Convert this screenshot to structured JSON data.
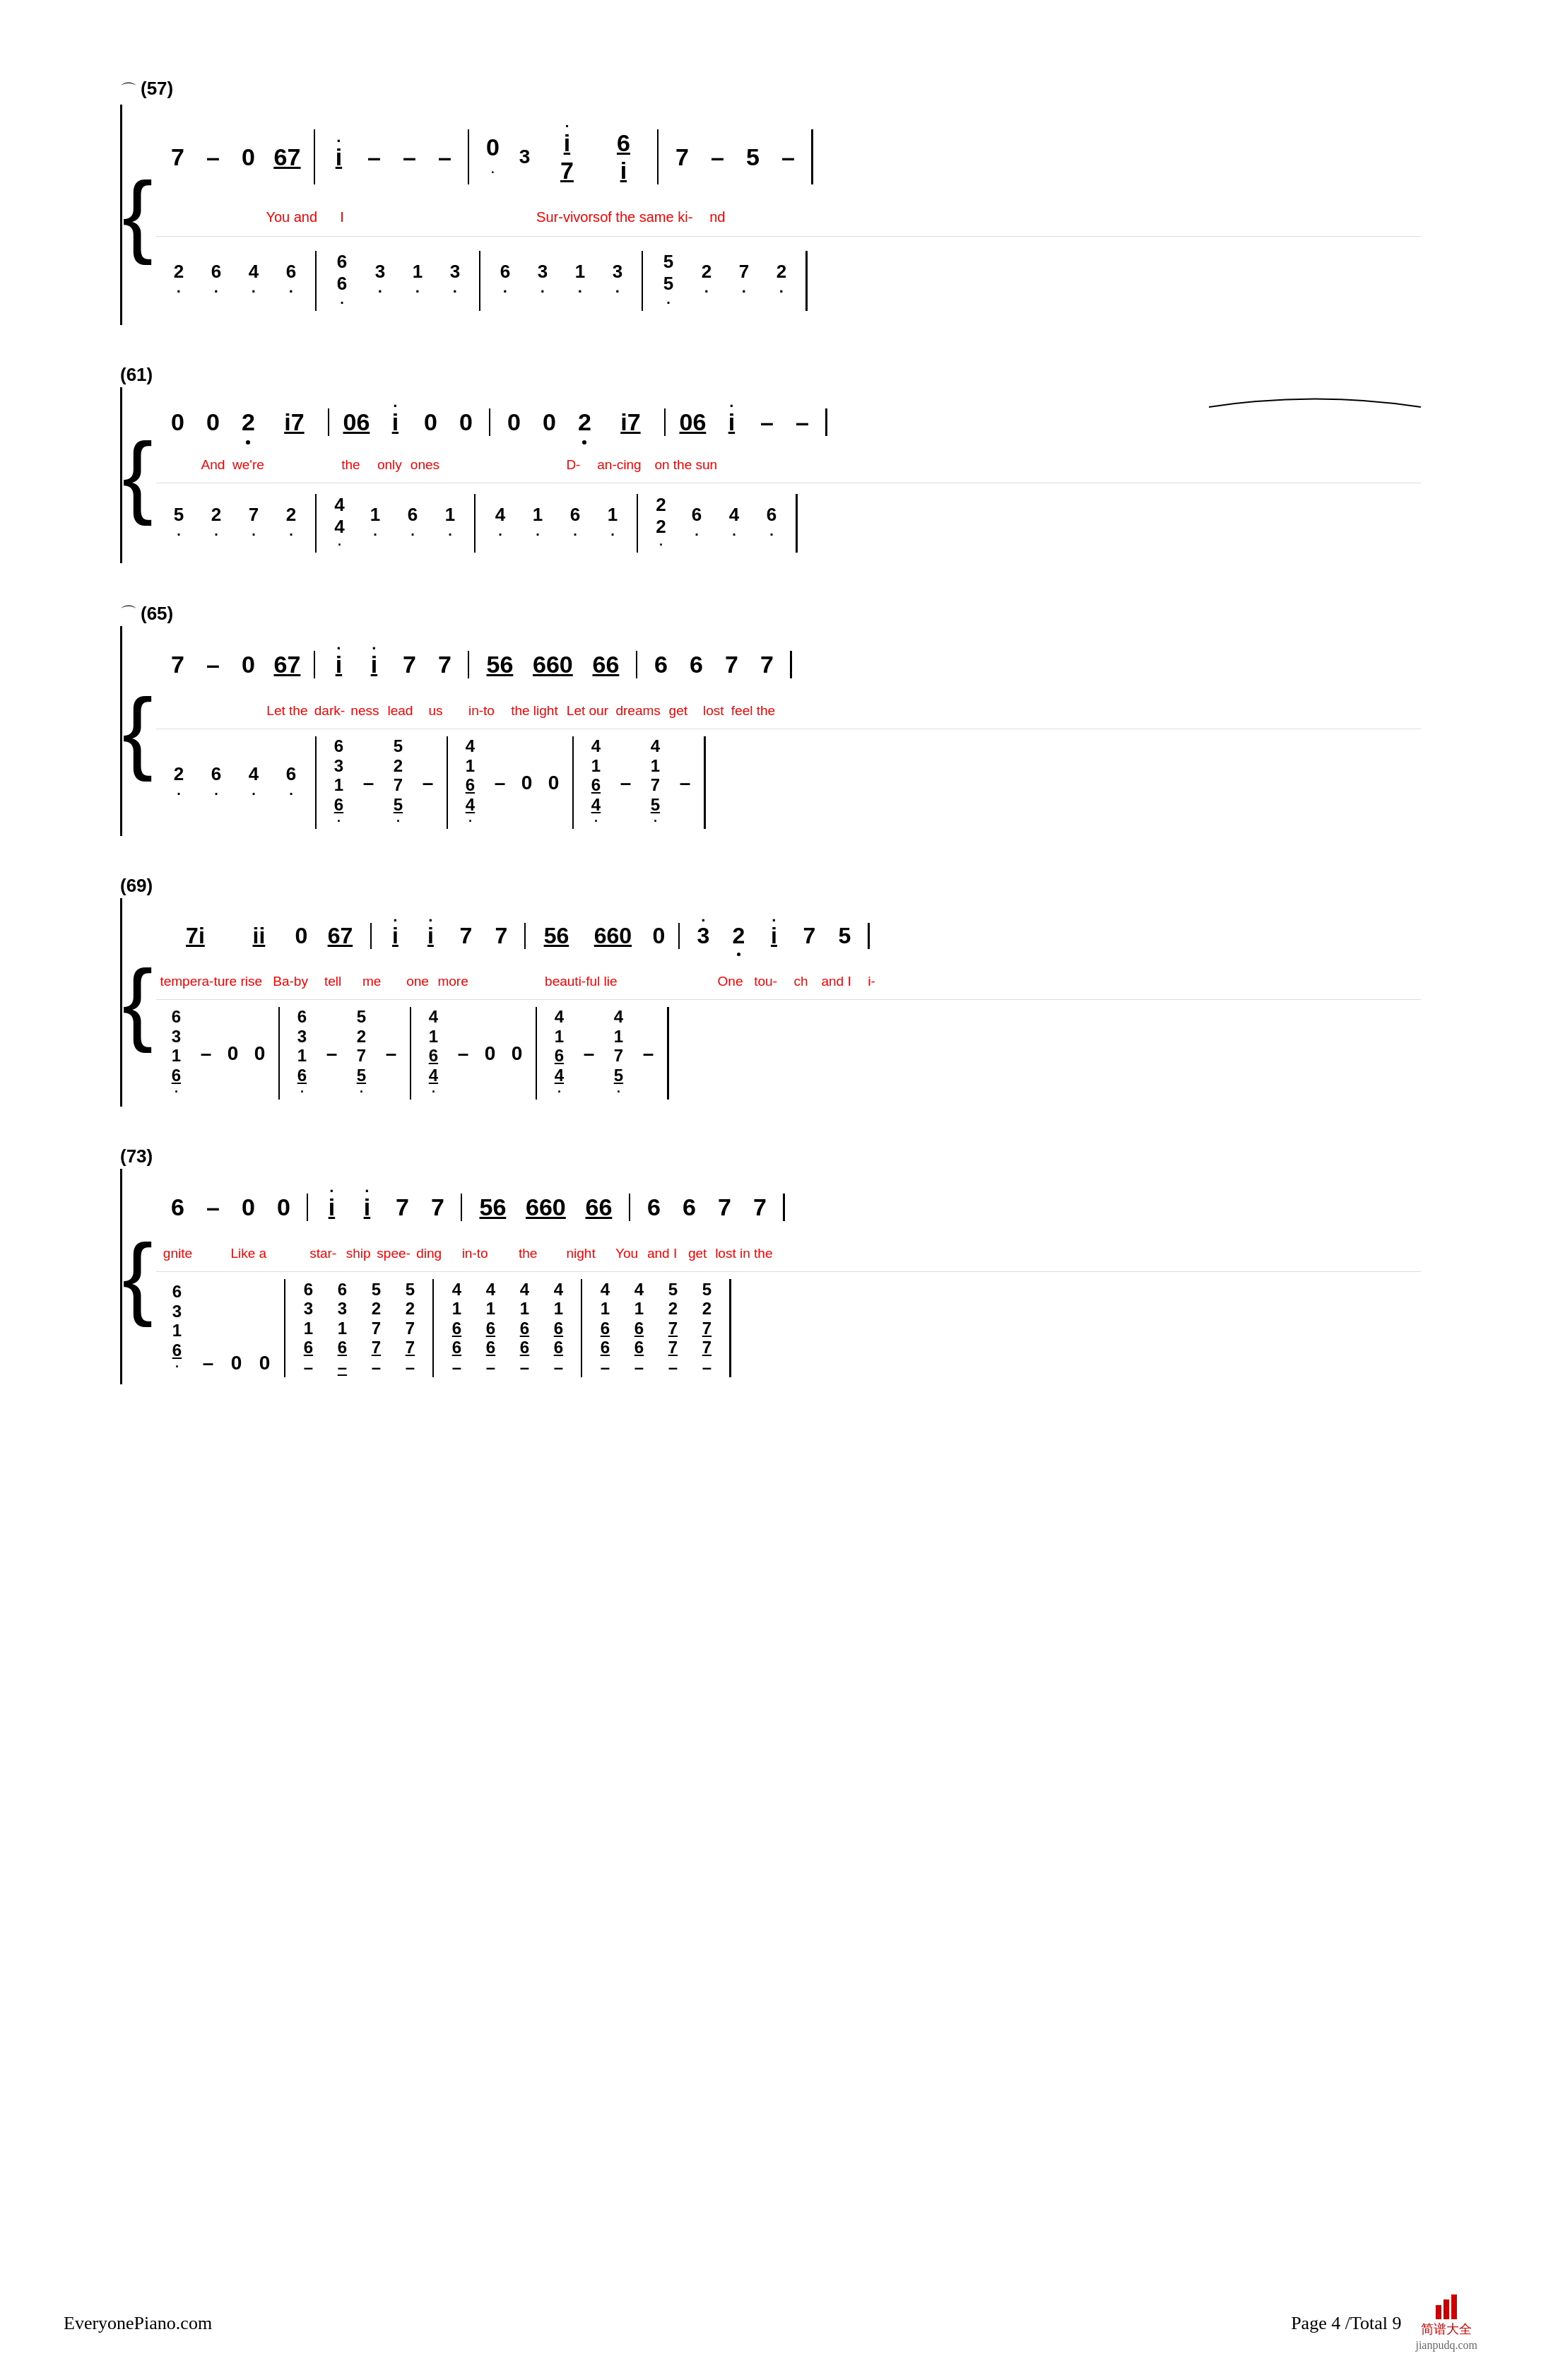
{
  "page": {
    "footer": {
      "website": "EveryonePiano.com",
      "page_info": "Page 4 /Total 9"
    }
  },
  "sections": [
    {
      "id": "57",
      "label": "(57)",
      "has_curve": true,
      "treble": {
        "notes": [
          "7",
          "–",
          "0",
          "67",
          "i",
          "–",
          "–",
          "–",
          "0·",
          "3",
          "i7",
          "6i",
          "7",
          "–",
          "5",
          "–"
        ],
        "underlines": [
          "67",
          "i7",
          "6i"
        ],
        "dots_above": [
          "i7"
        ],
        "lyrics": [
          "You and",
          "I",
          "",
          "",
          "",
          "",
          "",
          "",
          "",
          "Sur-vivors",
          "of the same ki-",
          "nd",
          "",
          "",
          "",
          ""
        ]
      },
      "bass": {
        "chords": [
          {
            "nums": [
              "2",
              "·"
            ]
          },
          {
            "nums": [
              "6",
              "·"
            ]
          },
          {
            "nums": [
              "4",
              "·"
            ]
          },
          {
            "nums": [
              "6",
              "·"
            ]
          },
          {
            "nums": [
              "6",
              "6",
              "·"
            ]
          },
          {
            "nums": [
              "3",
              "·"
            ]
          },
          {
            "nums": [
              "1",
              "·"
            ]
          },
          {
            "nums": [
              "3",
              "·"
            ]
          },
          {
            "nums": [
              "6",
              "·"
            ]
          },
          {
            "nums": [
              "3",
              "·"
            ]
          },
          {
            "nums": [
              "1",
              "·"
            ]
          },
          {
            "nums": [
              "3",
              "·"
            ]
          },
          {
            "nums": [
              "5",
              "5",
              "·"
            ]
          },
          {
            "nums": [
              "2",
              "·"
            ]
          },
          {
            "nums": [
              "7",
              "·"
            ]
          },
          {
            "nums": [
              "2",
              "·"
            ]
          }
        ]
      }
    },
    {
      "id": "61",
      "label": "(61)",
      "has_curve": false,
      "slur_right": true,
      "treble": {
        "notes": [
          "0",
          "0",
          "2̣",
          "i7",
          "06",
          "i",
          "0",
          "0",
          "0",
          "0",
          "2̣",
          "i7",
          "06",
          "i",
          "–",
          "–"
        ],
        "underlines": [
          "06",
          "i7"
        ],
        "lyrics": [
          "And",
          "we're",
          "the",
          "only",
          "ones",
          "",
          "",
          "",
          "D-",
          "an-cing",
          "on the sun",
          "",
          "",
          "",
          "",
          ""
        ]
      },
      "bass": {
        "chords": [
          {
            "nums": [
              "5",
              "·"
            ]
          },
          {
            "nums": [
              "2",
              "·"
            ]
          },
          {
            "nums": [
              "7",
              "·"
            ]
          },
          {
            "nums": [
              "2",
              "·"
            ]
          },
          {
            "nums": [
              "4",
              "4",
              "·"
            ]
          },
          {
            "nums": [
              "1",
              "·"
            ]
          },
          {
            "nums": [
              "6",
              "·"
            ]
          },
          {
            "nums": [
              "1",
              "·"
            ]
          },
          {
            "nums": [
              "4",
              "·"
            ]
          },
          {
            "nums": [
              "1",
              "·"
            ]
          },
          {
            "nums": [
              "6",
              "·"
            ]
          },
          {
            "nums": [
              "1",
              "·"
            ]
          },
          {
            "nums": [
              "2",
              "2",
              "·"
            ]
          },
          {
            "nums": [
              "6",
              "·"
            ]
          },
          {
            "nums": [
              "4",
              "·"
            ]
          },
          {
            "nums": [
              "6",
              "·"
            ]
          }
        ]
      }
    },
    {
      "id": "65",
      "label": "(65)",
      "has_curve": true,
      "treble": {
        "notes": [
          "7",
          "–",
          "0",
          "67",
          "i",
          "i",
          "7",
          "7",
          "56",
          "660",
          "66",
          "6",
          "6",
          "7",
          "7"
        ],
        "underlines": [
          "67",
          "56",
          "660",
          "66"
        ],
        "lyrics": [
          "Let the",
          "dark-",
          "ness",
          "lead",
          "us",
          "in-to",
          "the light",
          "Let our",
          "dreams",
          "get",
          "lost",
          "feel the",
          "",
          "",
          ""
        ]
      },
      "bass": {
        "chords_complex": true
      }
    },
    {
      "id": "69",
      "label": "(69)",
      "treble": {
        "notes": [
          "7i",
          "ii",
          "0",
          "67",
          "i",
          "i",
          "7",
          "7",
          "56",
          "660",
          "0",
          "3̣",
          "2̣",
          "i",
          "7",
          "5"
        ],
        "underlines": [
          "7i",
          "ii",
          "67",
          "56",
          "660"
        ],
        "lyrics": [
          "tempera-ture rise",
          "Ba-by",
          "tell",
          "me",
          "one",
          "more",
          "beauti-ful lie",
          "One",
          "tou-",
          "ch",
          "and I",
          "i-",
          "",
          "",
          "",
          ""
        ]
      },
      "bass": {
        "chords_complex": true
      }
    },
    {
      "id": "73",
      "label": "(73)",
      "treble": {
        "notes": [
          "6",
          "–",
          "0",
          "0",
          "i",
          "i",
          "7",
          "7",
          "56",
          "660",
          "66",
          "6",
          "6",
          "7",
          "7"
        ],
        "underlines": [
          "56",
          "660",
          "66"
        ],
        "lyrics": [
          "gnite",
          "",
          "Like a",
          "star-",
          "ship",
          "spee-",
          "ding",
          "in-to",
          "the",
          "night",
          "You",
          "and I",
          "get",
          "lost in the",
          "",
          ""
        ]
      },
      "bass": {
        "chords_complex": true
      }
    }
  ]
}
